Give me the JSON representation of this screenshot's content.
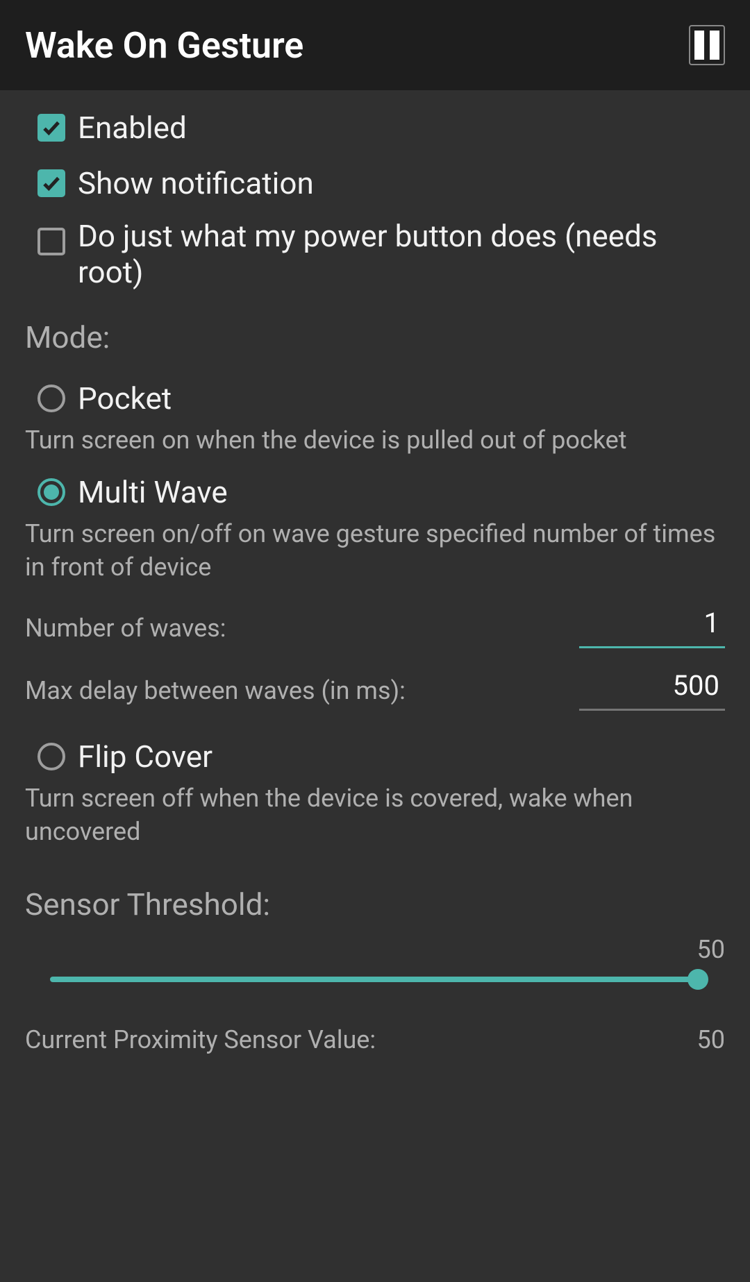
{
  "header": {
    "title": "Wake On Gesture"
  },
  "checkboxes": {
    "enabled": {
      "label": "Enabled",
      "checked": true
    },
    "show_notification": {
      "label": "Show notification",
      "checked": true
    },
    "power_button": {
      "label": "Do just what my power button does (needs root)",
      "checked": false
    }
  },
  "mode_section": {
    "label": "Mode:",
    "options": {
      "pocket": {
        "label": "Pocket",
        "desc": "Turn screen on when the device is pulled out of pocket",
        "selected": false
      },
      "multiwave": {
        "label": "Multi Wave",
        "desc": "Turn screen on/off on wave gesture specified number of times in front of device",
        "selected": true
      },
      "flipcover": {
        "label": "Flip Cover",
        "desc": "Turn screen off when the device is covered, wake when uncovered",
        "selected": false
      }
    }
  },
  "inputs": {
    "number_of_waves": {
      "label": "Number of waves:",
      "value": "1"
    },
    "max_delay": {
      "label": "Max delay between waves (in ms):",
      "value": "500"
    }
  },
  "sensor": {
    "threshold_label": "Sensor Threshold:",
    "threshold_value": "50",
    "current_label": "Current Proximity Sensor Value:",
    "current_value": "50"
  }
}
